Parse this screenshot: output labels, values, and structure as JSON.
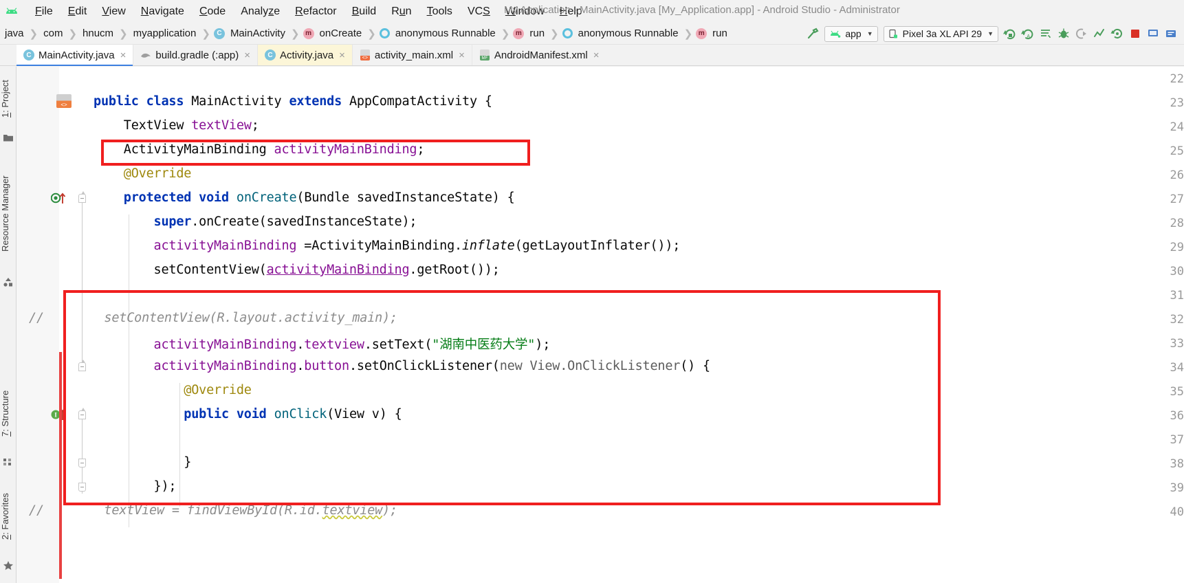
{
  "window": {
    "title": "My Application - MainActivity.java [My_Application.app] - Android Studio - Administrator",
    "logo_icon": "android-logo"
  },
  "menu": {
    "items": [
      {
        "label": "File",
        "acc": "F"
      },
      {
        "label": "Edit",
        "acc": "E"
      },
      {
        "label": "View",
        "acc": "V"
      },
      {
        "label": "Navigate",
        "acc": "N"
      },
      {
        "label": "Code",
        "acc": "C"
      },
      {
        "label": "Analyze",
        "acc": "z"
      },
      {
        "label": "Refactor",
        "acc": "R"
      },
      {
        "label": "Build",
        "acc": "B"
      },
      {
        "label": "Run",
        "acc": "u"
      },
      {
        "label": "Tools",
        "acc": "T"
      },
      {
        "label": "VCS",
        "acc": "S"
      },
      {
        "label": "Window",
        "acc": "W"
      },
      {
        "label": "Help",
        "acc": "H"
      }
    ]
  },
  "breadcrumb": {
    "items": [
      {
        "label": "java",
        "icon": ""
      },
      {
        "label": "com",
        "icon": ""
      },
      {
        "label": "hnucm",
        "icon": ""
      },
      {
        "label": "myapplication",
        "icon": ""
      },
      {
        "label": "MainActivity",
        "icon": "class-icon",
        "icon_letter": "C"
      },
      {
        "label": "onCreate",
        "icon": "method-icon",
        "icon_letter": "m"
      },
      {
        "label": "anonymous Runnable",
        "icon": "runnable-icon",
        "icon_letter": ""
      },
      {
        "label": "run",
        "icon": "method-icon",
        "icon_letter": "m"
      },
      {
        "label": "anonymous Runnable",
        "icon": "runnable-icon",
        "icon_letter": ""
      },
      {
        "label": "run",
        "icon": "method-icon",
        "icon_letter": "m"
      }
    ]
  },
  "toolbar": {
    "build_icon": "hammer-icon",
    "app_config": "app",
    "app_config_icon": "android-head-icon",
    "device": "Pixel 3a XL API 29",
    "device_icon": "phone-icon",
    "buttons": [
      {
        "name": "run-button",
        "icon": "run-green-arrow-icon"
      },
      {
        "name": "apply-changes-button",
        "icon": "apply-changes-icon"
      },
      {
        "name": "apply-code-changes-button",
        "icon": "apply-code-changes-icon"
      },
      {
        "name": "logcat-button",
        "icon": "logcat-icon"
      },
      {
        "name": "debug-button",
        "icon": "bug-icon"
      },
      {
        "name": "attach-debugger-button",
        "icon": "attach-debugger-icon"
      },
      {
        "name": "profiler-button",
        "icon": "profiler-icon"
      },
      {
        "name": "sync-project-button",
        "icon": "sync-gradle-icon"
      },
      {
        "name": "stop-button",
        "icon": "stop-square-icon"
      },
      {
        "name": "avd-manager-button",
        "icon": "avd-manager-icon"
      },
      {
        "name": "sdk-manager-button",
        "icon": "sdk-manager-icon"
      }
    ]
  },
  "tabs": [
    {
      "label": "MainActivity.java",
      "icon": "java-class-icon",
      "state": "active",
      "close": "×"
    },
    {
      "label": "build.gradle (:app)",
      "icon": "gradle-icon",
      "state": "normal",
      "close": "×"
    },
    {
      "label": "Activity.java",
      "icon": "java-class-icon",
      "state": "highlighted",
      "close": "×"
    },
    {
      "label": "activity_main.xml",
      "icon": "layout-xml-icon",
      "state": "normal",
      "close": "×"
    },
    {
      "label": "AndroidManifest.xml",
      "icon": "manifest-xml-icon",
      "state": "normal",
      "close": "×"
    }
  ],
  "left_tools": [
    {
      "label": "1: Project",
      "icon": "project-folder-icon"
    },
    {
      "label": "Resource Manager",
      "icon": "resource-manager-icon"
    },
    {
      "label": "7: Structure",
      "icon": "structure-icon"
    },
    {
      "label": "2: Favorites",
      "icon": "favorites-star-icon"
    }
  ],
  "editor": {
    "file": "MainActivity.java",
    "first_line": 22,
    "lines": [
      {
        "n": 22,
        "text": ""
      },
      {
        "n": 23,
        "text": "public class MainActivity extends AppCompatActivity {"
      },
      {
        "n": 24,
        "text": "    TextView textView;"
      },
      {
        "n": 25,
        "text": "    ActivityMainBinding activityMainBinding;"
      },
      {
        "n": 26,
        "text": "    @Override"
      },
      {
        "n": 27,
        "text": "    protected void onCreate(Bundle savedInstanceState) {"
      },
      {
        "n": 28,
        "text": "        super.onCreate(savedInstanceState);"
      },
      {
        "n": 29,
        "text": "        activityMainBinding =ActivityMainBinding.inflate(getLayoutInflater());"
      },
      {
        "n": 30,
        "text": "        setContentView(activityMainBinding.getRoot());"
      },
      {
        "n": 31,
        "text": ""
      },
      {
        "n": 32,
        "text": "//        setContentView(R.layout.activity_main);"
      },
      {
        "n": 33,
        "text": "        activityMainBinding.textview.setText(\"湖南中医药大学\");"
      },
      {
        "n": 34,
        "text": "        activityMainBinding.button.setOnClickListener(new View.OnClickListener() {"
      },
      {
        "n": 35,
        "text": "            @Override"
      },
      {
        "n": 36,
        "text": "            public void onClick(View v) {"
      },
      {
        "n": 37,
        "text": ""
      },
      {
        "n": 38,
        "text": "            }"
      },
      {
        "n": 39,
        "text": "        });"
      },
      {
        "n": 40,
        "text": "//        textView = findViewById(R.id.textview);"
      }
    ],
    "gutter_markers": [
      {
        "line": 23,
        "icon": "bean-class-marker-icon",
        "label": "<>"
      },
      {
        "line": 27,
        "icon": "run-method-marker-icon"
      },
      {
        "line": 36,
        "icon": "intention-bulb-icon",
        "label": "I"
      }
    ],
    "annotations": [
      {
        "name": "red-highlight-box-line25",
        "lines": "25"
      },
      {
        "name": "red-highlight-box-lines31-39",
        "lines": "31-39"
      }
    ]
  },
  "colors": {
    "accent": "#3c7fe0",
    "annotation_red": "#f01f1f",
    "keyword_blue": "#0033b3",
    "field_purple": "#871094",
    "string_green": "#067d17",
    "comment_gray": "#8c8c8c",
    "annotation_yellow": "#9e880d",
    "android_green": "#3ddc84"
  }
}
